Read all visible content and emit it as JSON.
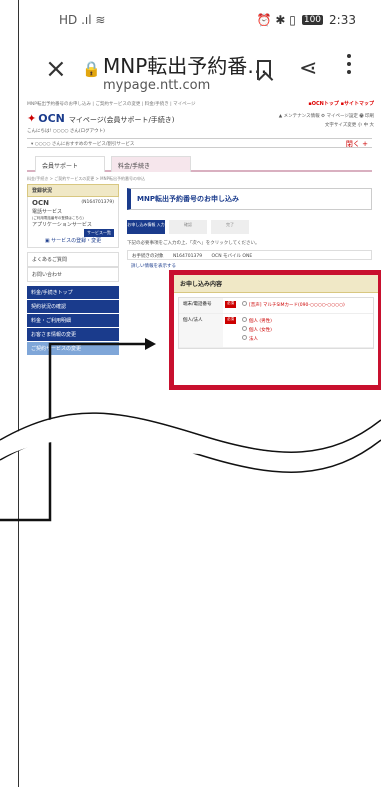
{
  "statusbar": {
    "left_icons": "HD .ıl ≋",
    "right_icons": "⏰ ✱ ▯",
    "battery": "100",
    "time": "2:33"
  },
  "browser": {
    "page_title": "MNP転出予約番…",
    "host": "mypage.ntt.com"
  },
  "site": {
    "topline": "MNP転出予約番号のお申し込み | ご契約サービスの変更 | 料金/手続き | マイページ",
    "toplinks": "▪OCNトップ ▪サイトマップ",
    "logo": "OCN",
    "logo_sub": "マイページ(会員サポート/手続き)",
    "greeting": "こんにちは! ○○○○ さん(ログアウト)",
    "top_right_1": "▲ メンテナンス情報  ⚙ マイページ設定  🖶 印刷",
    "top_right_2": "文字サイズ変更 小 中 大",
    "recbar": "▾ ○○○○ さんにおすすめのサービス/割引サービス",
    "recbar_more": "閉く +",
    "tab_support": "会員サポート",
    "tab_procedure": "料金/手続き",
    "breadcrumb": "料金/手続き > ご契約サービスの変更 > MNP転出予約番号の申込"
  },
  "sidebar": {
    "head": "登録状況",
    "ocn_label": "OCN",
    "ocn_id": "(N164701379)",
    "phone_label": "電話サービス",
    "phone_note": "(ご利用電話番号の登録はこちら)",
    "app_label": "アプリケーションサービス",
    "app_btn": "サービス一覧",
    "reg_link": "▣ サービスの登録・変更",
    "faq": "よくあるご質問",
    "contact": "お問い合わせ",
    "nav": [
      "料金/手続きトップ",
      "契約状況の確認",
      "料金・ご利用明細",
      "お客さま情報の変更",
      "ご契約サービスの変更"
    ]
  },
  "content": {
    "title": "MNP転出予約番号のお申し込み",
    "steps": [
      "お申し込み情報 入力",
      "確認",
      "完了"
    ],
    "note": "下記の必要事項をご入力の上、「次へ」をクリックしてください。",
    "contract_label": "お手続きの対象",
    "contract_id": "N164701379",
    "contract_plan": "OCN モバイル ONE",
    "detail_link": "詳しい情報を表示する"
  },
  "form": {
    "head": "お申し込み内容",
    "row1_label": "端末/電話番号",
    "row1_value": "[音声] マルチSIMカード(090-○○○○-○○○○)",
    "row2_label": "個人/法人",
    "required": "必須",
    "options": [
      "個人 (男性)",
      "個人 (女性)",
      "法人"
    ]
  }
}
